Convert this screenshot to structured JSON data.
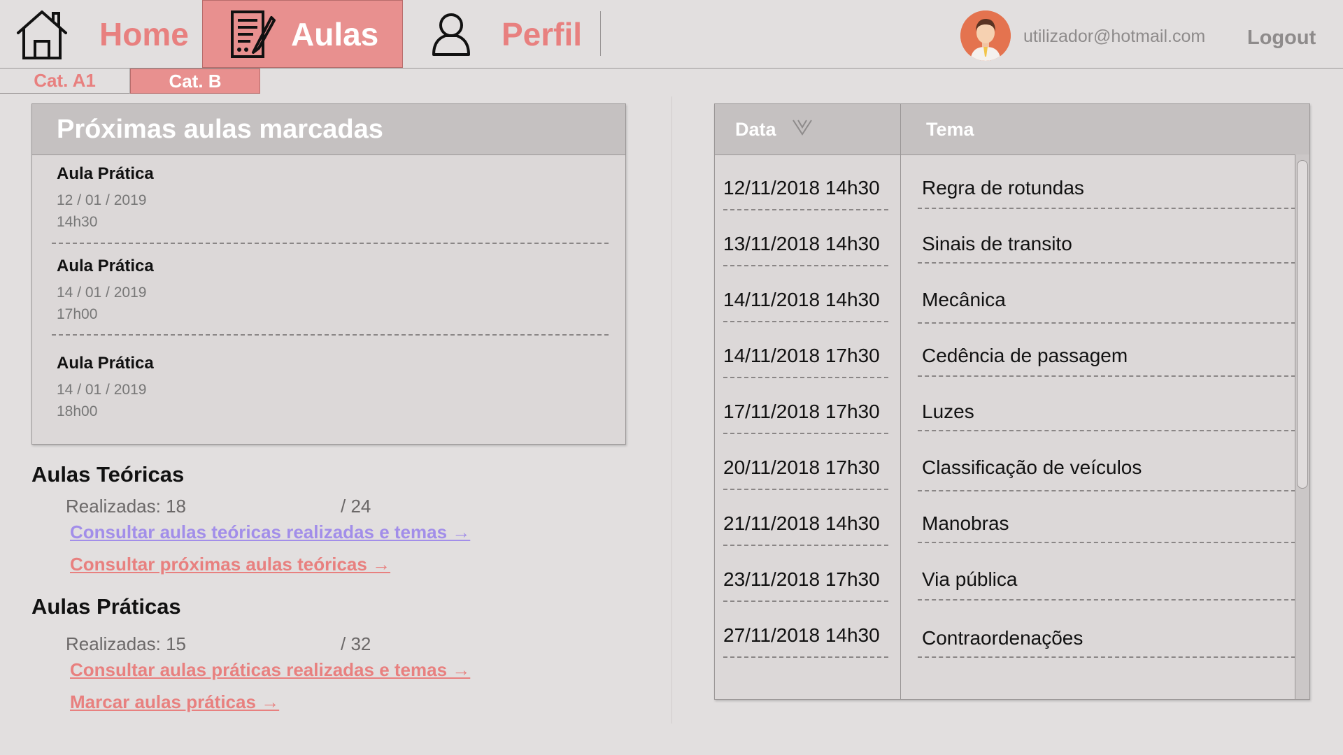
{
  "nav": {
    "home": "Home",
    "aulas": "Aulas",
    "perfil": "Perfil"
  },
  "user": {
    "email": "utilizador@hotmail.com",
    "logout": "Logout"
  },
  "categories": [
    {
      "label": "Cat. A1",
      "active": false
    },
    {
      "label": "Cat. B",
      "active": true
    }
  ],
  "upcoming": {
    "title": "Próximas aulas marcadas",
    "lessons": [
      {
        "title": "Aula Prática",
        "date": "12 / 01 / 2019",
        "time": "14h30"
      },
      {
        "title": "Aula Prática",
        "date": "14 / 01 / 2019",
        "time": "17h00"
      },
      {
        "title": "Aula Prática",
        "date": "14 / 01 / 2019",
        "time": "18h00"
      }
    ]
  },
  "teoricas": {
    "title": "Aulas Teóricas",
    "realizadas_label": "Realizadas: 18",
    "total_label": "/ 24",
    "link_realizadas": "Consultar aulas teóricas realizadas e temas →",
    "link_proximas": "Consultar próximas aulas teóricas →"
  },
  "praticas": {
    "title": "Aulas Práticas",
    "realizadas_label": "Realizadas: 15",
    "total_label": "/ 32",
    "link_realizadas": "Consultar aulas práticas realizadas e temas →",
    "link_marcar": "Marcar aulas práticas →"
  },
  "table": {
    "col_data": "Data",
    "col_tema": "Tema",
    "rows": [
      {
        "date": "12/11/2018 14h30",
        "topic": "Regra de rotundas"
      },
      {
        "date": "13/11/2018 14h30",
        "topic": "Sinais de transito"
      },
      {
        "date": "14/11/2018 14h30",
        "topic": "Mecânica"
      },
      {
        "date": "14/11/2018 17h30",
        "topic": "Cedência de passagem"
      },
      {
        "date": "17/11/2018 17h30",
        "topic": "Luzes"
      },
      {
        "date": "20/11/2018 17h30",
        "topic": "Classificação de veículos"
      },
      {
        "date": "21/11/2018 14h30",
        "topic": "Manobras"
      },
      {
        "date": "23/11/2018 17h30",
        "topic": "Via pública"
      },
      {
        "date": "27/11/2018 14h30",
        "topic": "Contraordenações"
      }
    ]
  },
  "colors": {
    "accent": "#e8807f",
    "accent_bg": "#e8908f",
    "visited_link": "#a28ee9",
    "panel_header": "#c5c1c1",
    "background": "#e2dfdf"
  },
  "icons": {
    "home": "house-icon",
    "aulas": "document-edit-icon",
    "perfil": "user-outline-icon",
    "sort": "chevron-down-icon"
  }
}
